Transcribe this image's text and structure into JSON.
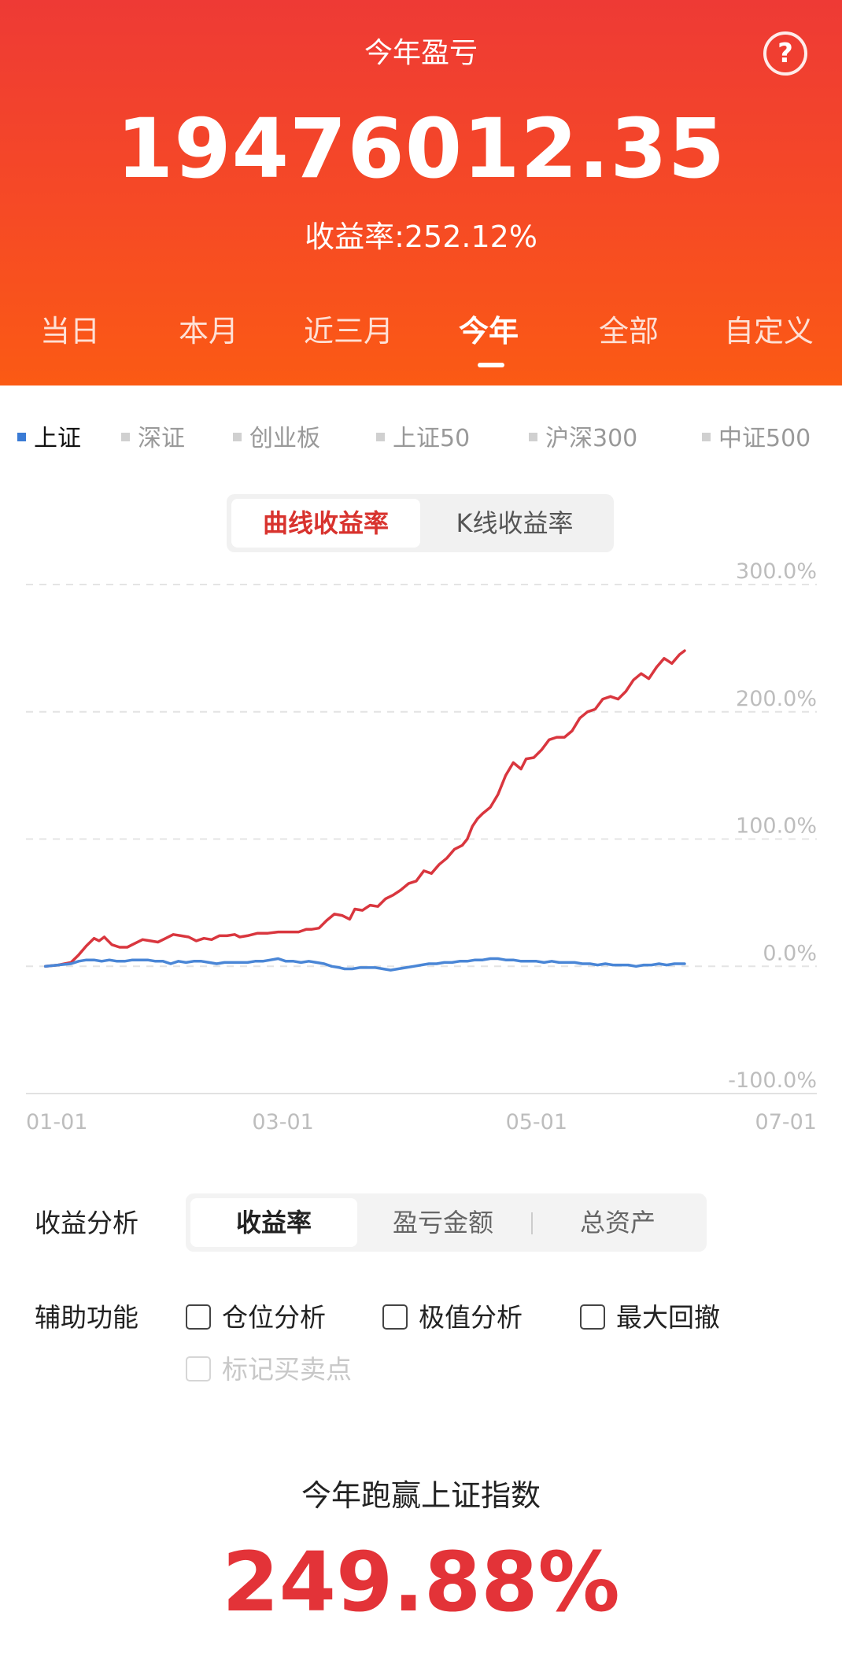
{
  "header": {
    "title": "今年盈亏",
    "amount": "19476012.35",
    "rate": "收益率:252.12%",
    "help_icon": "question-icon"
  },
  "tabs": [
    {
      "label": "当日"
    },
    {
      "label": "本月"
    },
    {
      "label": "近三月"
    },
    {
      "label": "今年",
      "active": true
    },
    {
      "label": "全部"
    },
    {
      "label": "自定义"
    }
  ],
  "legend": [
    {
      "label": "上证",
      "active": true,
      "color": "#3a7bd5"
    },
    {
      "label": "深证"
    },
    {
      "label": "创业板"
    },
    {
      "label": "上证50"
    },
    {
      "label": "沪深300"
    },
    {
      "label": "中证500"
    }
  ],
  "chart_mode": {
    "options": [
      "曲线收益率",
      "K线收益率"
    ],
    "selected": "曲线收益率"
  },
  "chart_data": {
    "type": "line",
    "y_ticks": [
      "300.0%",
      "200.0%",
      "100.0%",
      "0.0%",
      "-100.0%"
    ],
    "ylim": [
      -100,
      300
    ],
    "x_ticks": [
      "01-01",
      "03-01",
      "05-01",
      "07-01"
    ],
    "x_tick_values": [
      0,
      59,
      120,
      181
    ],
    "xlim": [
      0,
      181
    ],
    "grid": true,
    "series": [
      {
        "color": "#d9363e",
        "points": [
          [
            3,
            0
          ],
          [
            8,
            1
          ],
          [
            13,
            3
          ],
          [
            16,
            9
          ],
          [
            19,
            16
          ],
          [
            22,
            22
          ],
          [
            24,
            20
          ],
          [
            26,
            23
          ],
          [
            29,
            17
          ],
          [
            32,
            15
          ],
          [
            35,
            15
          ],
          [
            38,
            18
          ],
          [
            41,
            21
          ],
          [
            44,
            20
          ],
          [
            47,
            19
          ],
          [
            50,
            22
          ],
          [
            53,
            25
          ],
          [
            56,
            24
          ],
          [
            59,
            23
          ],
          [
            62,
            20
          ],
          [
            65,
            22
          ],
          [
            68,
            21
          ],
          [
            71,
            24
          ],
          [
            74,
            24
          ],
          [
            77,
            25
          ],
          [
            79,
            23
          ],
          [
            82,
            24
          ],
          [
            86,
            26
          ],
          [
            90,
            26
          ],
          [
            94,
            27
          ],
          [
            98,
            27
          ],
          [
            102,
            27
          ],
          [
            105,
            29
          ],
          [
            107,
            29
          ],
          [
            110,
            30
          ],
          [
            113,
            36
          ],
          [
            116,
            41
          ],
          [
            119,
            40
          ],
          [
            122,
            37
          ],
          [
            124,
            45
          ],
          [
            127,
            44
          ],
          [
            130,
            48
          ],
          [
            133,
            47
          ],
          [
            136,
            53
          ],
          [
            139,
            56
          ],
          [
            142,
            60
          ],
          [
            145,
            65
          ],
          [
            148,
            67
          ],
          [
            151,
            75
          ],
          [
            154,
            73
          ],
          [
            157,
            80
          ],
          [
            160,
            85
          ],
          [
            163,
            92
          ],
          [
            166,
            95
          ],
          [
            168,
            100
          ],
          [
            170,
            110
          ],
          [
            172,
            116
          ],
          [
            174,
            120
          ],
          [
            177,
            125
          ],
          [
            180,
            135
          ],
          [
            183,
            150
          ],
          [
            186,
            160
          ],
          [
            189,
            155
          ],
          [
            191,
            163
          ],
          [
            194,
            164
          ],
          [
            197,
            170
          ],
          [
            200,
            178
          ],
          [
            203,
            180
          ],
          [
            206,
            180
          ],
          [
            209,
            185
          ],
          [
            212,
            195
          ],
          [
            215,
            200
          ],
          [
            218,
            202
          ],
          [
            221,
            210
          ],
          [
            224,
            212
          ],
          [
            227,
            210
          ],
          [
            230,
            216
          ],
          [
            233,
            225
          ],
          [
            236,
            230
          ],
          [
            239,
            226
          ],
          [
            242,
            235
          ],
          [
            245,
            242
          ],
          [
            248,
            238
          ],
          [
            251,
            245
          ],
          [
            253,
            248
          ]
        ]
      },
      {
        "color": "#4a86d6",
        "points": [
          [
            3,
            0
          ],
          [
            8,
            1
          ],
          [
            13,
            2
          ],
          [
            16,
            4
          ],
          [
            19,
            5
          ],
          [
            22,
            5
          ],
          [
            25,
            4
          ],
          [
            28,
            5
          ],
          [
            31,
            4
          ],
          [
            34,
            4
          ],
          [
            37,
            5
          ],
          [
            40,
            5
          ],
          [
            43,
            5
          ],
          [
            46,
            4
          ],
          [
            49,
            4
          ],
          [
            52,
            2
          ],
          [
            55,
            4
          ],
          [
            58,
            3
          ],
          [
            61,
            4
          ],
          [
            64,
            4
          ],
          [
            67,
            3
          ],
          [
            70,
            2
          ],
          [
            73,
            3
          ],
          [
            76,
            3
          ],
          [
            79,
            3
          ],
          [
            82,
            3
          ],
          [
            85,
            4
          ],
          [
            88,
            4
          ],
          [
            91,
            5
          ],
          [
            94,
            6
          ],
          [
            97,
            4
          ],
          [
            100,
            4
          ],
          [
            103,
            3
          ],
          [
            106,
            4
          ],
          [
            109,
            3
          ],
          [
            112,
            2
          ],
          [
            115,
            0
          ],
          [
            118,
            -1
          ],
          [
            120,
            -2
          ],
          [
            123,
            -2
          ],
          [
            126,
            -1
          ],
          [
            129,
            -1
          ],
          [
            132,
            -1
          ],
          [
            135,
            -2
          ],
          [
            138,
            -3
          ],
          [
            141,
            -2
          ],
          [
            144,
            -1
          ],
          [
            147,
            0
          ],
          [
            150,
            1
          ],
          [
            153,
            2
          ],
          [
            156,
            2
          ],
          [
            159,
            3
          ],
          [
            162,
            3
          ],
          [
            165,
            4
          ],
          [
            168,
            4
          ],
          [
            171,
            5
          ],
          [
            174,
            5
          ],
          [
            177,
            6
          ],
          [
            180,
            6
          ],
          [
            183,
            5
          ],
          [
            186,
            5
          ],
          [
            189,
            4
          ],
          [
            192,
            4
          ],
          [
            195,
            4
          ],
          [
            198,
            3
          ],
          [
            201,
            4
          ],
          [
            204,
            3
          ],
          [
            207,
            3
          ],
          [
            210,
            3
          ],
          [
            213,
            2
          ],
          [
            216,
            2
          ],
          [
            219,
            1
          ],
          [
            222,
            2
          ],
          [
            225,
            1
          ],
          [
            228,
            1
          ],
          [
            231,
            1
          ],
          [
            234,
            0
          ],
          [
            237,
            1
          ],
          [
            240,
            1
          ],
          [
            243,
            2
          ],
          [
            246,
            1
          ],
          [
            249,
            2
          ],
          [
            253,
            2
          ]
        ]
      }
    ]
  },
  "analysis": {
    "label": "收益分析",
    "options": [
      "收益率",
      "盈亏金额",
      "总资产"
    ],
    "selected": "收益率"
  },
  "aux": {
    "label": "辅助功能",
    "options": [
      {
        "label": "仓位分析",
        "checked": false
      },
      {
        "label": "极值分析",
        "checked": false
      },
      {
        "label": "最大回撤",
        "checked": false
      },
      {
        "label": "标记买卖点",
        "checked": false,
        "disabled": true
      }
    ]
  },
  "outperform": {
    "label": "今年跑赢上证指数",
    "value": "249.88%"
  }
}
